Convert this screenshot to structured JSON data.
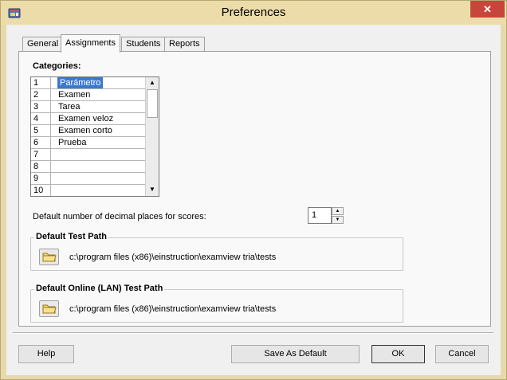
{
  "window": {
    "title": "Preferences",
    "close_glyph": "✕"
  },
  "tabs": [
    {
      "label": "General"
    },
    {
      "label": "Assignments"
    },
    {
      "label": "Students"
    },
    {
      "label": "Reports"
    }
  ],
  "categories": {
    "label": "Categories:",
    "rows": [
      {
        "num": "1",
        "name": "Parámetro"
      },
      {
        "num": "2",
        "name": "Examen"
      },
      {
        "num": "3",
        "name": "Tarea"
      },
      {
        "num": "4",
        "name": "Examen veloz"
      },
      {
        "num": "5",
        "name": "Examen corto"
      },
      {
        "num": "6",
        "name": "Prueba"
      },
      {
        "num": "7",
        "name": ""
      },
      {
        "num": "8",
        "name": ""
      },
      {
        "num": "9",
        "name": ""
      },
      {
        "num": "10",
        "name": ""
      }
    ],
    "scroll_up_glyph": "▲",
    "scroll_down_glyph": "▼"
  },
  "decimals": {
    "label": "Default number of decimal places for scores:",
    "value": "1",
    "up_glyph": "▲",
    "down_glyph": "▼"
  },
  "test_path": {
    "title": "Default Test Path",
    "value": "c:\\program files (x86)\\einstruction\\examview tria\\tests"
  },
  "online_path": {
    "title": "Default Online (LAN) Test Path",
    "value": "c:\\program files (x86)\\einstruction\\examview tria\\tests"
  },
  "buttons": {
    "help": "Help",
    "save_default": "Save As Default",
    "ok": "OK",
    "cancel": "Cancel"
  },
  "colors": {
    "title_bar": "#ecdca9",
    "close_button": "#c7463c",
    "selection": "#3a79cf"
  },
  "icons": {
    "app": "app-icon",
    "folder": "folder-icon",
    "close": "close-icon"
  }
}
